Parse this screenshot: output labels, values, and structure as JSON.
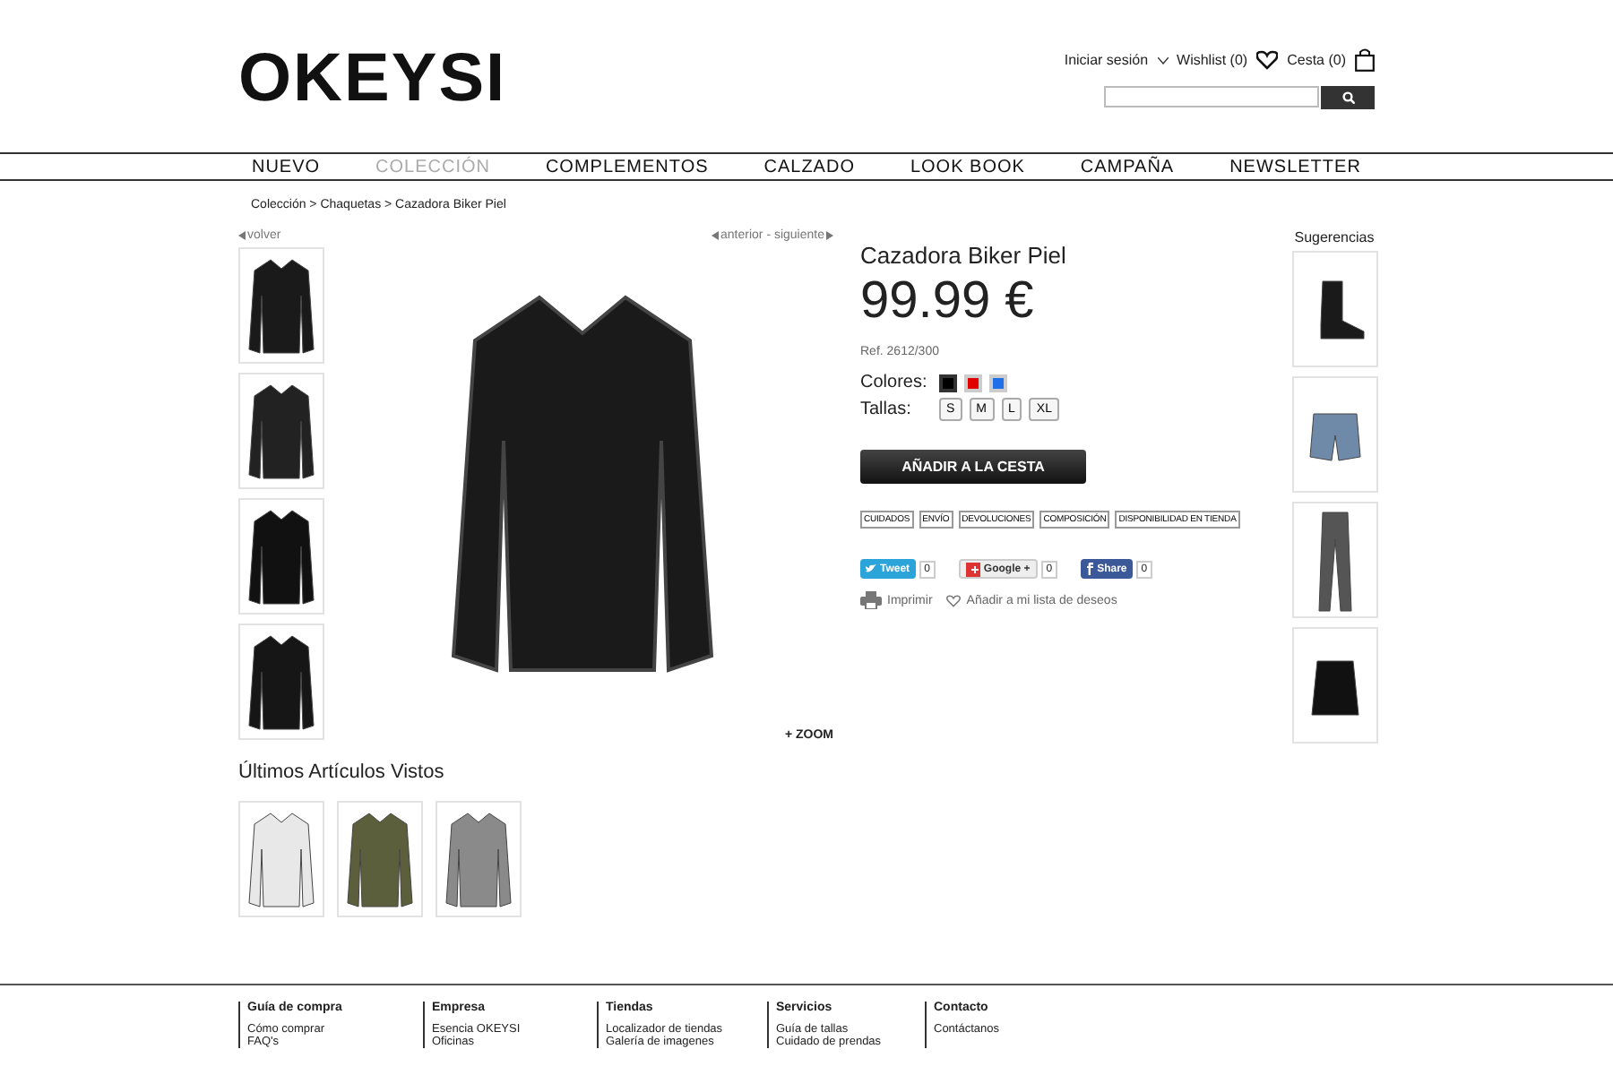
{
  "header": {
    "logo": "OKEYSI",
    "login": "Iniciar sesión",
    "wishlist": "Wishlist (0)",
    "cart": "Cesta (0)"
  },
  "nav": [
    {
      "label": "NUEVO",
      "selected": false
    },
    {
      "label": "COLECCIÓN",
      "selected": true
    },
    {
      "label": "COMPLEMENTOS",
      "selected": false
    },
    {
      "label": "CALZADO",
      "selected": false
    },
    {
      "label": "LOOK BOOK",
      "selected": false
    },
    {
      "label": "CAMPAÑA",
      "selected": false
    },
    {
      "label": "NEWSLETTER",
      "selected": false
    }
  ],
  "breadcrumb": "Colección > Chaquetas > Cazadora Biker Piel",
  "back_link": "volver",
  "prev_next": "anterior - siguiente",
  "thumbnails": [
    {
      "kind": "jacket-front"
    },
    {
      "kind": "jacket-side"
    },
    {
      "kind": "jacket-back"
    },
    {
      "kind": "jacket-flat"
    }
  ],
  "zoom_link": "+ ZOOM",
  "product": {
    "title": "Cazadora Biker Piel",
    "price": "99.99 €",
    "ref": "Ref. 2612/300",
    "colors_label": "Colores:",
    "colors": [
      {
        "color": "#000000",
        "selected": true
      },
      {
        "color": "#e00000",
        "selected": false
      },
      {
        "color": "#1f6fe8",
        "selected": false
      }
    ],
    "sizes_label": "Tallas:",
    "sizes": [
      {
        "label": "S"
      },
      {
        "label": "M"
      },
      {
        "label": "L"
      },
      {
        "label": "XL"
      }
    ],
    "add_button": "AÑADIR A LA CESTA",
    "info_tabs": [
      "CUIDADOS",
      "ENVÍO",
      "DEVOLUCIONES",
      "COMPOSICIÓN",
      "DISPONIBILIDAD EN TIENDA"
    ],
    "social": [
      {
        "kind": "twitter",
        "label": "Tweet",
        "count": "0"
      },
      {
        "kind": "google",
        "label": "Google +",
        "count": "0"
      },
      {
        "kind": "facebook",
        "label": "Share",
        "count": "0"
      }
    ],
    "print": "Imprimir",
    "add_wishlist": "Añadir a mi lista de deseos"
  },
  "suggestions": {
    "title": "Sugerencias",
    "items": [
      {
        "kind": "boot"
      },
      {
        "kind": "shorts"
      },
      {
        "kind": "jeans"
      },
      {
        "kind": "skirt"
      }
    ]
  },
  "recent": {
    "title": "Últimos Artículos Vistos",
    "items": [
      {
        "kind": "white-jacket"
      },
      {
        "kind": "green-jacket"
      },
      {
        "kind": "tweed-jacket"
      }
    ]
  },
  "footer": [
    {
      "title": "Guía de compra",
      "links": [
        "Cómo comprar",
        "FAQ's"
      ]
    },
    {
      "title": "Empresa",
      "links": [
        "Esencia OKEYSI",
        "Oficinas"
      ]
    },
    {
      "title": "Tiendas",
      "links": [
        "Localizador de tiendas",
        "Galería de imagenes"
      ]
    },
    {
      "title": "Servicios",
      "links": [
        "Guía de tallas",
        "Cuidado de prendas"
      ]
    },
    {
      "title": "Contacto",
      "links": [
        "Contáctanos"
      ]
    }
  ]
}
